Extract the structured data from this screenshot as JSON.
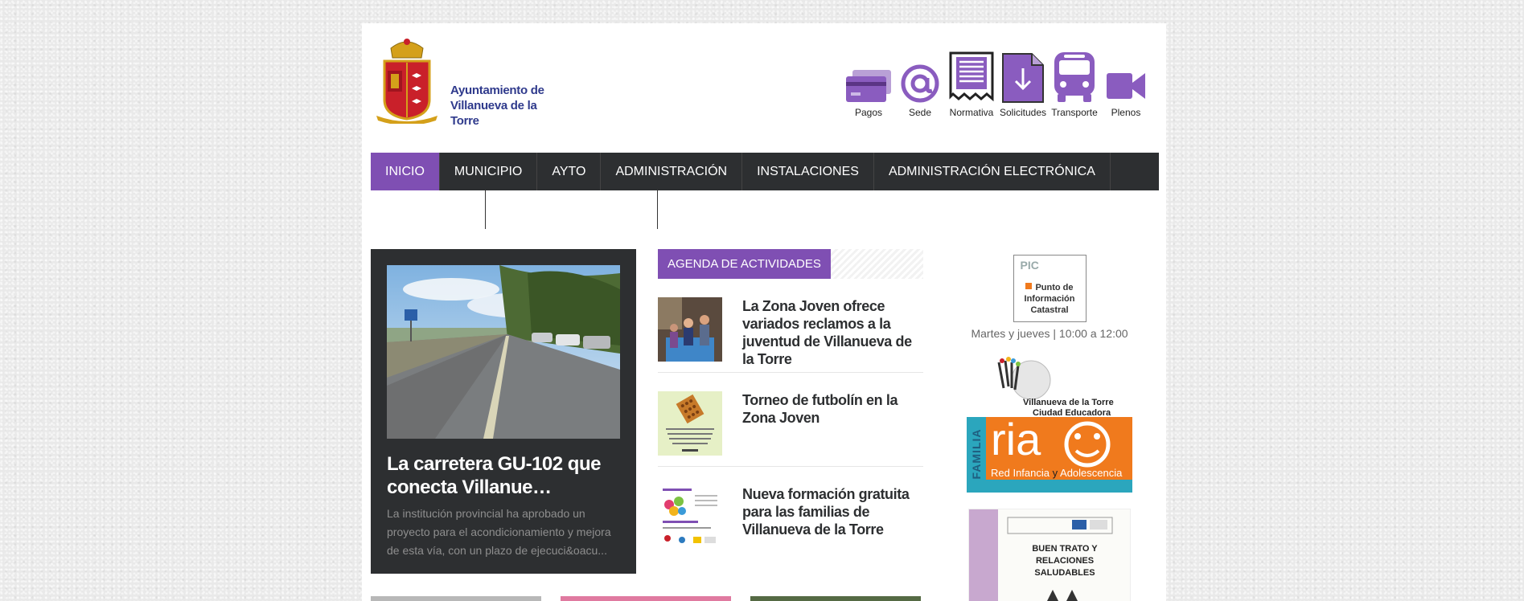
{
  "header": {
    "logo_line1": "Ayuntamiento de",
    "logo_line2": "Villanueva de la Torre",
    "quick_links": [
      {
        "label": "Pagos",
        "icon": "credit-card-icon"
      },
      {
        "label": "Sede",
        "icon": "at-sign-icon"
      },
      {
        "label": "Normativa",
        "icon": "document-icon"
      },
      {
        "label": "Solicitudes",
        "icon": "download-file-icon"
      },
      {
        "label": "Transporte",
        "icon": "bus-icon"
      },
      {
        "label": "Plenos",
        "icon": "video-camera-icon"
      }
    ]
  },
  "nav": {
    "items": [
      "INICIO",
      "MUNICIPIO",
      "AYTO",
      "ADMINISTRACIÓN",
      "INSTALACIONES",
      "ADMINISTRACIÓN ELECTRÓNICA"
    ]
  },
  "featured": {
    "title": "La carretera GU-102 que conecta Villanue…",
    "excerpt": "La institución provincial ha aprobado un proyecto para el acondicionamiento y mejora de esta vía, con un plazo de ejecuci&oacu..."
  },
  "agenda": {
    "heading": "AGENDA DE ACTIVIDADES",
    "items": [
      {
        "title": "La Zona Joven ofrece variados reclamos a la juventud de Villanueva de la Torre"
      },
      {
        "title": "Torneo de futbolín en la Zona Joven"
      },
      {
        "title": "Nueva formación gratuita para las familias de Villanueva de la Torre"
      }
    ]
  },
  "sidebar": {
    "pic_line1": "PIC",
    "pic_line2": "Punto de",
    "pic_line3": "Información",
    "pic_line4": "Catastral",
    "pic_schedule": "Martes y jueves | 10:00 a 12:00",
    "ciudad_line1": "Villanueva de la Torre",
    "ciudad_line2": "Ciudad Educadora",
    "familia": "FAMILIA",
    "ria": "ria",
    "red_infancia": "Red Infancia",
    "y": "y",
    "adolescencia": "Adolescencia",
    "buen_trato": "BUEN TRATO Y RELACIONES SALUDABLES"
  },
  "colors": {
    "accent": "#7f4fb3",
    "nav_bg": "#2d2f31",
    "orange": "#f07a1d",
    "teal": "#2ba6bd"
  }
}
